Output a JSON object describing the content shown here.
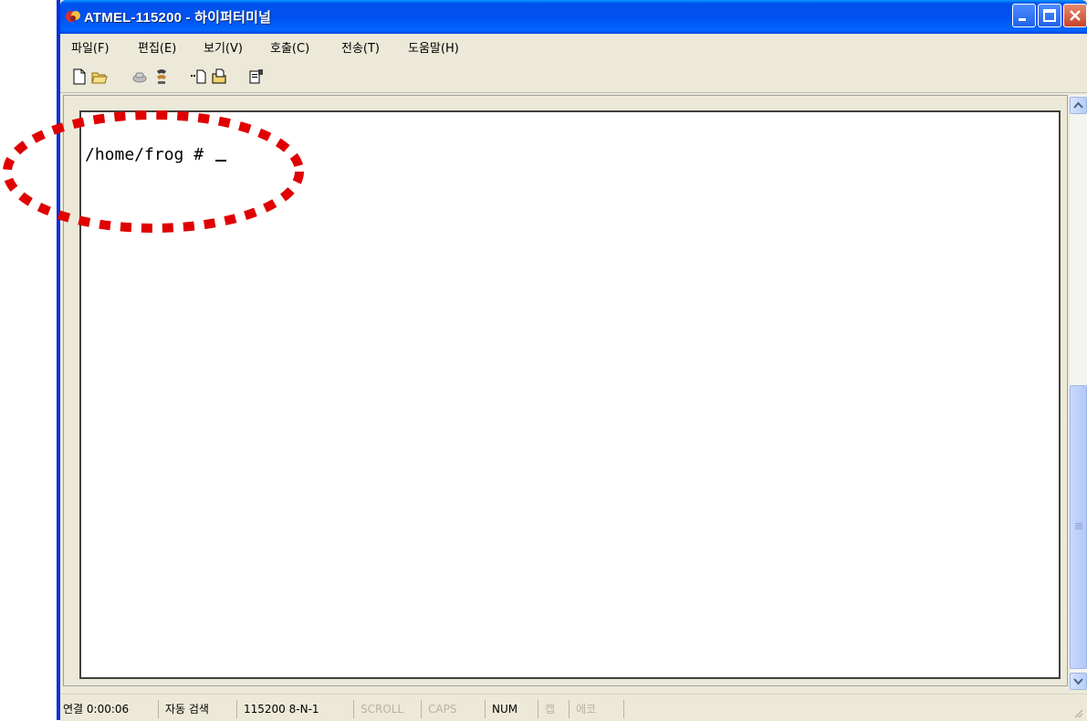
{
  "window": {
    "title": "ATMEL-115200 - 하이퍼터미널",
    "accent_color": "#0054e3",
    "buttons": [
      "minimize-icon",
      "maximize-icon",
      "close-icon"
    ]
  },
  "menu": {
    "items": [
      "파일(F)",
      "편집(E)",
      "보기(V)",
      "호출(C)",
      "전송(T)",
      "도움말(H)"
    ]
  },
  "toolbar": {
    "icons": [
      "new-file-icon",
      "open-folder-icon",
      "call-icon",
      "disconnect-icon",
      "send-file-icon",
      "receive-file-icon",
      "properties-icon"
    ]
  },
  "terminal": {
    "prompt": "/home/frog # "
  },
  "status": {
    "connected": "연결 0:00:06",
    "detect": "자동 검색",
    "baud": "115200 8-N-1",
    "scroll": "SCROLL",
    "caps": "CAPS",
    "num": "NUM",
    "capture": "캡",
    "echo": "에코"
  },
  "annotation": {
    "color": "#e00000",
    "style": "dashed-ellipse"
  }
}
